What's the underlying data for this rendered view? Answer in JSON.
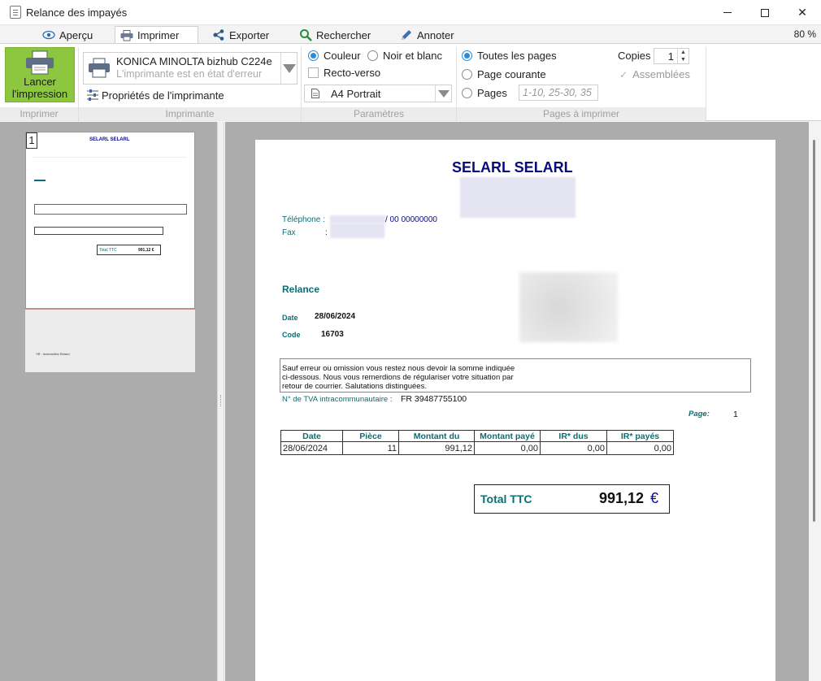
{
  "window": {
    "title": "Relance des impayés"
  },
  "tabs": [
    {
      "label": "Aperçu",
      "icon": "eye-icon"
    },
    {
      "label": "Imprimer",
      "icon": "printer-icon"
    },
    {
      "label": "Exporter",
      "icon": "share-icon"
    },
    {
      "label": "Rechercher",
      "icon": "search-icon"
    },
    {
      "label": "Annoter",
      "icon": "pencil-icon"
    }
  ],
  "zoom": "80 %",
  "ribbon": {
    "print_button": {
      "line1": "Lancer",
      "line2": "l'impression"
    },
    "printer": {
      "name": "KONICA MINOLTA bizhub C224e",
      "status": "L'imprimante est en état d'erreur",
      "properties_label": "Propriétés de l'imprimante"
    },
    "params": {
      "color_label": "Couleur",
      "bw_label": "Noir et blanc",
      "duplex_label": "Recto-verso",
      "paper": "A4 Portrait"
    },
    "pages": {
      "all_label": "Toutes les pages",
      "current_label": "Page courante",
      "pages_label": "Pages",
      "pages_placeholder": "1-10, 25-30, 35",
      "copies_label": "Copies",
      "copies_value": "1",
      "collate_label": "Assemblées"
    },
    "groups": {
      "print": "Imprimer",
      "printer": "Imprimante",
      "params": "Paramètres",
      "pages": "Pages à imprimer"
    }
  },
  "thumbnail": {
    "page_number": "1",
    "company": "SELARL SELARL",
    "footer": "*IR : Indemnités Retard",
    "total_label": "Total TTC",
    "total_value": "991,12 €"
  },
  "document": {
    "company": "SELARL SELARL",
    "phone_label": "Téléphone :",
    "phone_value": "/ 00 00000000",
    "fax_label": "Fax",
    "fax_sep": ":",
    "heading": "Relance",
    "date_label": "Date",
    "date_value": "28/06/2024",
    "code_label": "Code",
    "code_value": "16703",
    "message_line1": "Sauf erreur ou omission vous restez nous devoir la somme indiquée",
    "message_line2": "ci-dessous. Nous vous remerdions de régulariser votre situation par",
    "message_line3": "retour de courrier. Salutations distinguées.",
    "vat_label": "N° de TVA intracommunautaire :",
    "vat_value": "FR 39487755100",
    "page_label": "Page:",
    "page_value": "1",
    "table": {
      "headers": [
        "Date",
        "Pièce",
        "Montant du",
        "Montant payé",
        "IR* dus",
        "IR* payés"
      ],
      "rows": [
        [
          "28/06/2024",
          "11",
          "991,12",
          "0,00",
          "0,00",
          "0,00"
        ]
      ]
    },
    "total_label": "Total TTC",
    "total_amount": "991,12",
    "total_currency": "€"
  }
}
